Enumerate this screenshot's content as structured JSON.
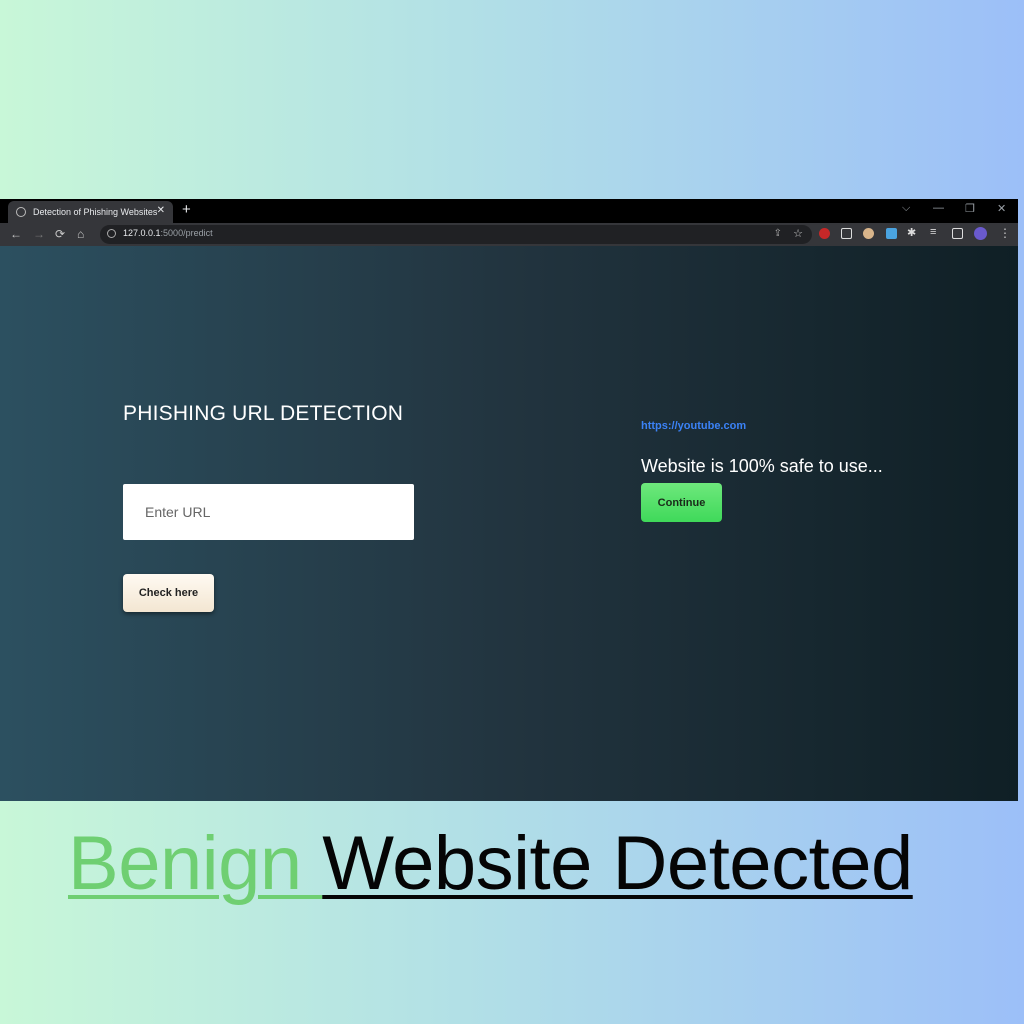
{
  "browser": {
    "tab_title": "Detection of Phishing Websites",
    "tab_close": "✕",
    "new_tab": "+",
    "url_host": "127.0.0.1",
    "url_path": ":5000/predict",
    "nav": {
      "back": "←",
      "forward": "→",
      "reload": "⟳",
      "home": "⌂"
    },
    "window": {
      "dropdown": "⌵",
      "minimize": "—",
      "restore": "❐",
      "close": "✕"
    },
    "menu": "⋮"
  },
  "page": {
    "heading": "PHISHING URL DETECTION",
    "input_placeholder": "Enter URL",
    "check_button": "Check here",
    "checked_url": "https://youtube.com",
    "result_message": "Website is 100% safe to use...",
    "continue_button": "Continue"
  },
  "caption": {
    "word1": "Benign ",
    "word2": "Website Detected"
  },
  "colors": {
    "benign_green": "#6fcf72",
    "continue_green": "#3fd95a",
    "link_blue": "#3b82f6"
  }
}
